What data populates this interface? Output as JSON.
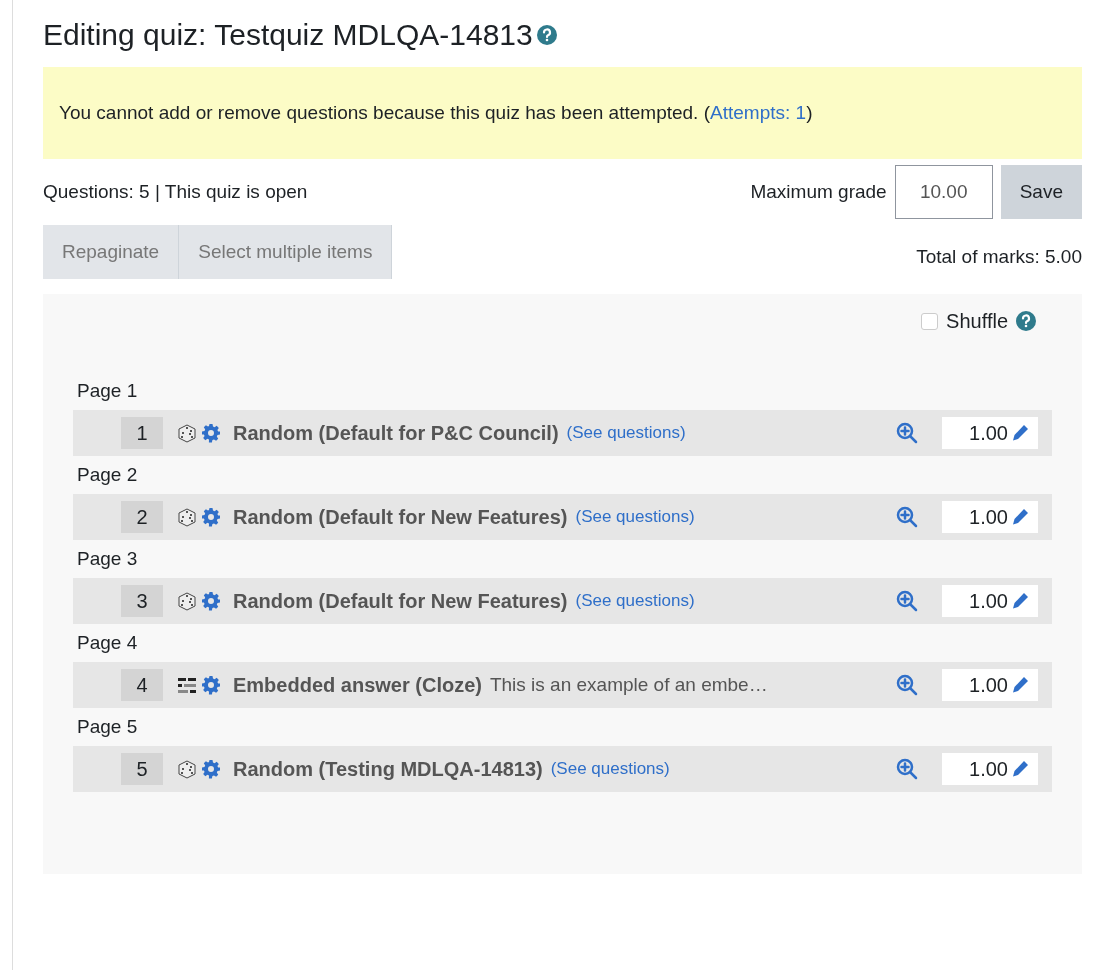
{
  "title": "Editing quiz: Testquiz MDLQA-14813",
  "notice": {
    "text": "You cannot add or remove questions because this quiz has been attempted. (",
    "link": "Attempts: 1",
    "after": ")"
  },
  "summary": "Questions: 5 | This quiz is open",
  "max_grade": {
    "label": "Maximum grade",
    "value": "10.00",
    "button": "Save"
  },
  "toolbar": [
    "Repaginate",
    "Select multiple items"
  ],
  "total": "Total of marks: 5.00",
  "shuffle": {
    "label": "Shuffle",
    "checked": false
  },
  "pages": [
    {
      "label": "Page 1",
      "slot": {
        "number": "1",
        "kind": "random",
        "name": "Random (Default for P&C Council)",
        "link": "(See questions)",
        "mark": "1.00"
      }
    },
    {
      "label": "Page 2",
      "slot": {
        "number": "2",
        "kind": "random",
        "name": "Random (Default for New Features)",
        "link": "(See questions)",
        "mark": "1.00"
      }
    },
    {
      "label": "Page 3",
      "slot": {
        "number": "3",
        "kind": "random",
        "name": "Random (Default for New Features)",
        "link": "(See questions)",
        "mark": "1.00"
      }
    },
    {
      "label": "Page 4",
      "slot": {
        "number": "4",
        "kind": "cloze",
        "name": "Embedded answer (Cloze)",
        "text": "This is an example of an embe…",
        "mark": "1.00"
      }
    },
    {
      "label": "Page 5",
      "slot": {
        "number": "5",
        "kind": "random",
        "name": "Random (Testing MDLQA-14813)",
        "link": "(See questions)",
        "mark": "1.00"
      }
    }
  ]
}
